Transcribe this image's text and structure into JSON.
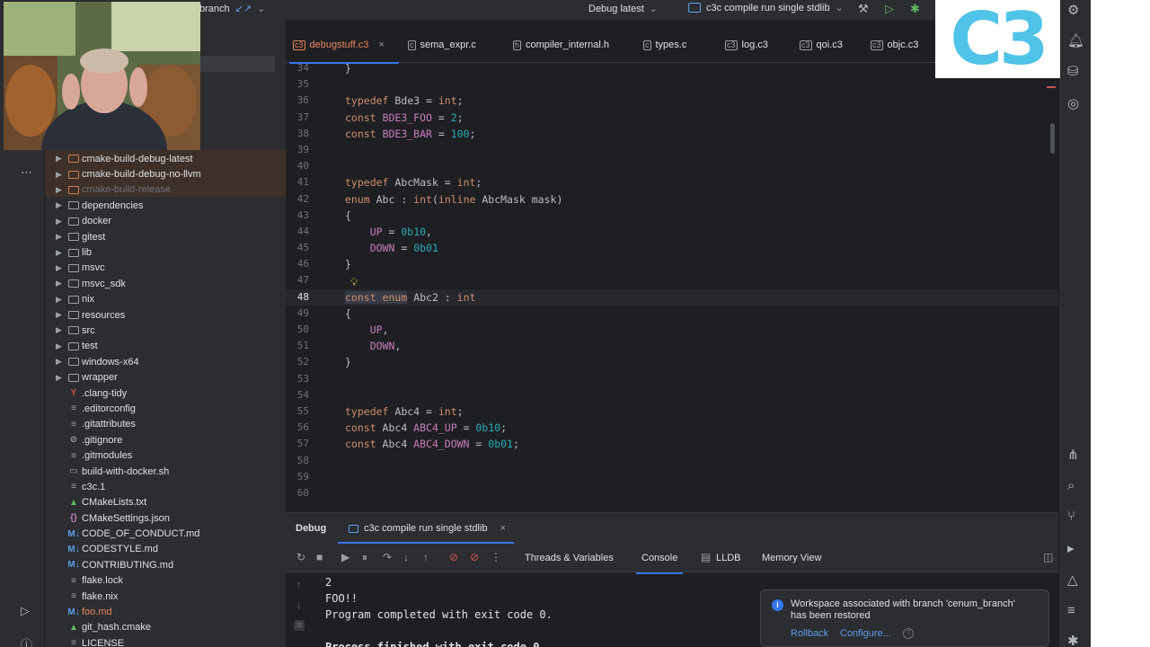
{
  "topbar": {
    "branch": "branch",
    "run_config": "Debug latest",
    "run_target": "c3c compile run single stdlib"
  },
  "logo": {
    "text": "C3"
  },
  "tree": {
    "items": [
      {
        "label": "cmake-build-debug-latest",
        "kind": "folder",
        "state": "excluded"
      },
      {
        "label": "cmake-build-debug-no-llvm",
        "kind": "folder",
        "state": "excluded"
      },
      {
        "label": "cmake-build-release",
        "kind": "folder",
        "state": "dim"
      },
      {
        "label": "dependencies",
        "kind": "folder"
      },
      {
        "label": "docker",
        "kind": "folder"
      },
      {
        "label": "gitest",
        "kind": "folder"
      },
      {
        "label": "lib",
        "kind": "folder"
      },
      {
        "label": "msvc",
        "kind": "folder"
      },
      {
        "label": "msvc_sdk",
        "kind": "folder"
      },
      {
        "label": "nix",
        "kind": "folder"
      },
      {
        "label": "resources",
        "kind": "folder"
      },
      {
        "label": "src",
        "kind": "folder"
      },
      {
        "label": "test",
        "kind": "folder"
      },
      {
        "label": "windows-x64",
        "kind": "folder"
      },
      {
        "label": "wrapper",
        "kind": "folder"
      },
      {
        "label": ".clang-tidy",
        "kind": "file",
        "icon": "Y"
      },
      {
        "label": ".editorconfig",
        "kind": "file",
        "icon": "≡"
      },
      {
        "label": ".gitattributes",
        "kind": "file",
        "icon": "≡"
      },
      {
        "label": ".gitignore",
        "kind": "file",
        "icon": "⊘"
      },
      {
        "label": ".gitmodules",
        "kind": "file",
        "icon": "≡"
      },
      {
        "label": "build-with-docker.sh",
        "kind": "file",
        "icon": "▭"
      },
      {
        "label": "c3c.1",
        "kind": "file",
        "icon": "≡"
      },
      {
        "label": "CMakeLists.txt",
        "kind": "file",
        "icon": "▲"
      },
      {
        "label": "CMakeSettings.json",
        "kind": "file",
        "icon": "{}"
      },
      {
        "label": "CODE_OF_CONDUCT.md",
        "kind": "file",
        "icon": "M↓"
      },
      {
        "label": "CODESTYLE.md",
        "kind": "file",
        "icon": "M↓"
      },
      {
        "label": "CONTRIBUTING.md",
        "kind": "file",
        "icon": "M↓"
      },
      {
        "label": "flake.lock",
        "kind": "file",
        "icon": "≡"
      },
      {
        "label": "flake.nix",
        "kind": "file",
        "icon": "≡"
      },
      {
        "label": "foo.md",
        "kind": "file",
        "icon": "M↓",
        "state": "modified"
      },
      {
        "label": "git_hash.cmake",
        "kind": "file",
        "icon": "▲"
      },
      {
        "label": "LICENSE",
        "kind": "file",
        "icon": "≡"
      }
    ]
  },
  "editor": {
    "tabs": [
      {
        "label": "debugstuff.c3",
        "icon": "c3",
        "active": true
      },
      {
        "label": "sema_expr.c",
        "icon": "c"
      },
      {
        "label": "compiler_internal.h",
        "icon": "h"
      },
      {
        "label": "types.c",
        "icon": "c"
      },
      {
        "label": "log.c3",
        "icon": "c3"
      },
      {
        "label": "qoi.c3",
        "icon": "c3"
      },
      {
        "label": "objc.c3",
        "icon": "c3"
      }
    ],
    "lines": [
      {
        "n": "34",
        "code": "}"
      },
      {
        "n": "35",
        "code": ""
      },
      {
        "n": "36",
        "code": "typedef Bde3 = int;"
      },
      {
        "n": "37",
        "code": "const BDE3_FOO = 2;"
      },
      {
        "n": "38",
        "code": "const BDE3_BAR = 100;"
      },
      {
        "n": "39",
        "code": ""
      },
      {
        "n": "40",
        "code": ""
      },
      {
        "n": "41",
        "code": "typedef AbcMask = int;"
      },
      {
        "n": "42",
        "code": "enum Abc : int(inline AbcMask mask)"
      },
      {
        "n": "43",
        "code": "{"
      },
      {
        "n": "44",
        "code": "    UP = 0b10,"
      },
      {
        "n": "45",
        "code": "    DOWN = 0b01"
      },
      {
        "n": "46",
        "code": "}"
      },
      {
        "n": "47",
        "code": ""
      },
      {
        "n": "48",
        "code": "const enum Abc2 : int"
      },
      {
        "n": "49",
        "code": "{"
      },
      {
        "n": "50",
        "code": "    UP,"
      },
      {
        "n": "51",
        "code": "    DOWN,"
      },
      {
        "n": "52",
        "code": "}"
      },
      {
        "n": "53",
        "code": ""
      },
      {
        "n": "54",
        "code": ""
      },
      {
        "n": "55",
        "code": "typedef Abc4 = int;"
      },
      {
        "n": "56",
        "code": "const Abc4 ABC4_UP = 0b10;"
      },
      {
        "n": "57",
        "code": "const Abc4 ABC4_DOWN = 0b01;"
      },
      {
        "n": "58",
        "code": ""
      },
      {
        "n": "59",
        "code": ""
      },
      {
        "n": "60",
        "code": ""
      }
    ]
  },
  "debug": {
    "title": "Debug",
    "session_tab": "c3c compile run single stdlib",
    "subtabs": [
      "Threads & Variables",
      "Console",
      "LLDB",
      "Memory View"
    ],
    "active_subtab": "Console",
    "console_lines": [
      "2",
      "FOO!!",
      "Program completed with exit code 0.",
      "",
      "Process finished with exit code 0"
    ]
  },
  "notification": {
    "message": "Workspace associated with branch 'cenum_branch' has been restored",
    "actions": [
      "Rollback",
      "Configure..."
    ]
  },
  "colors": {
    "accent": "#3574f0",
    "logo": "#4fc3e8",
    "modified": "#e8865a"
  }
}
